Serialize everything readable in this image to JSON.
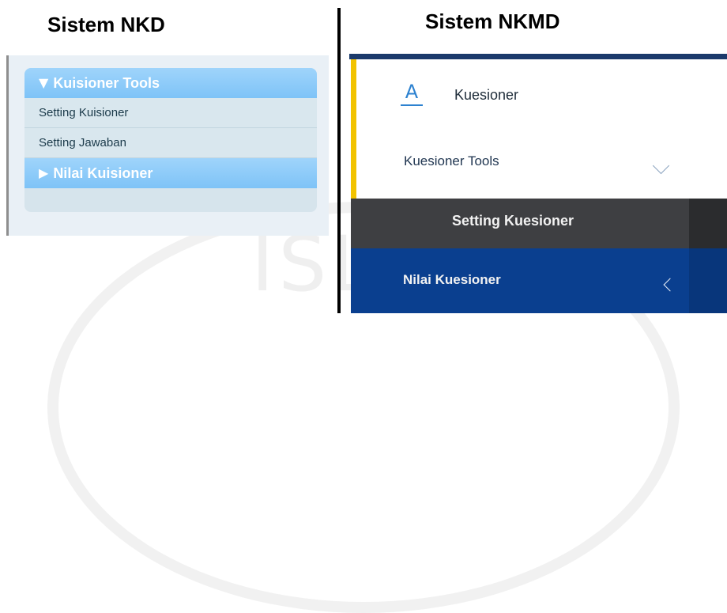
{
  "left_panel": {
    "title": "Sistem NKD",
    "header_tools": "Kuisioner Tools",
    "header_tools_icon": "triangle-down",
    "items": [
      {
        "label": "Setting Kuisioner"
      },
      {
        "label": "Setting Jawaban"
      }
    ],
    "header_nilai": "Nilai Kuisioner",
    "header_nilai_icon": "triangle-right"
  },
  "right_panel": {
    "title": "Sistem NKMD",
    "kuesioner": {
      "label": "Kuesioner",
      "icon": "font-a-icon"
    },
    "tools": {
      "label": "Kuesioner Tools",
      "icon": "chevron-down-icon"
    },
    "setting": {
      "label": "Setting Kuesioner"
    },
    "nilai": {
      "label": "Nilai Kuesioner",
      "icon": "chevron-left-icon"
    }
  },
  "watermark": {
    "text": "ISLAM"
  },
  "colors": {
    "nkd_header": "#8ccbf9",
    "nkd_bg": "#d6e4ec",
    "nkmd_navy": "#1b3a6b",
    "nkmd_yellow": "#f2c300",
    "nkmd_dark": "#3e3f42",
    "nkmd_blue": "#0a3f8f"
  }
}
